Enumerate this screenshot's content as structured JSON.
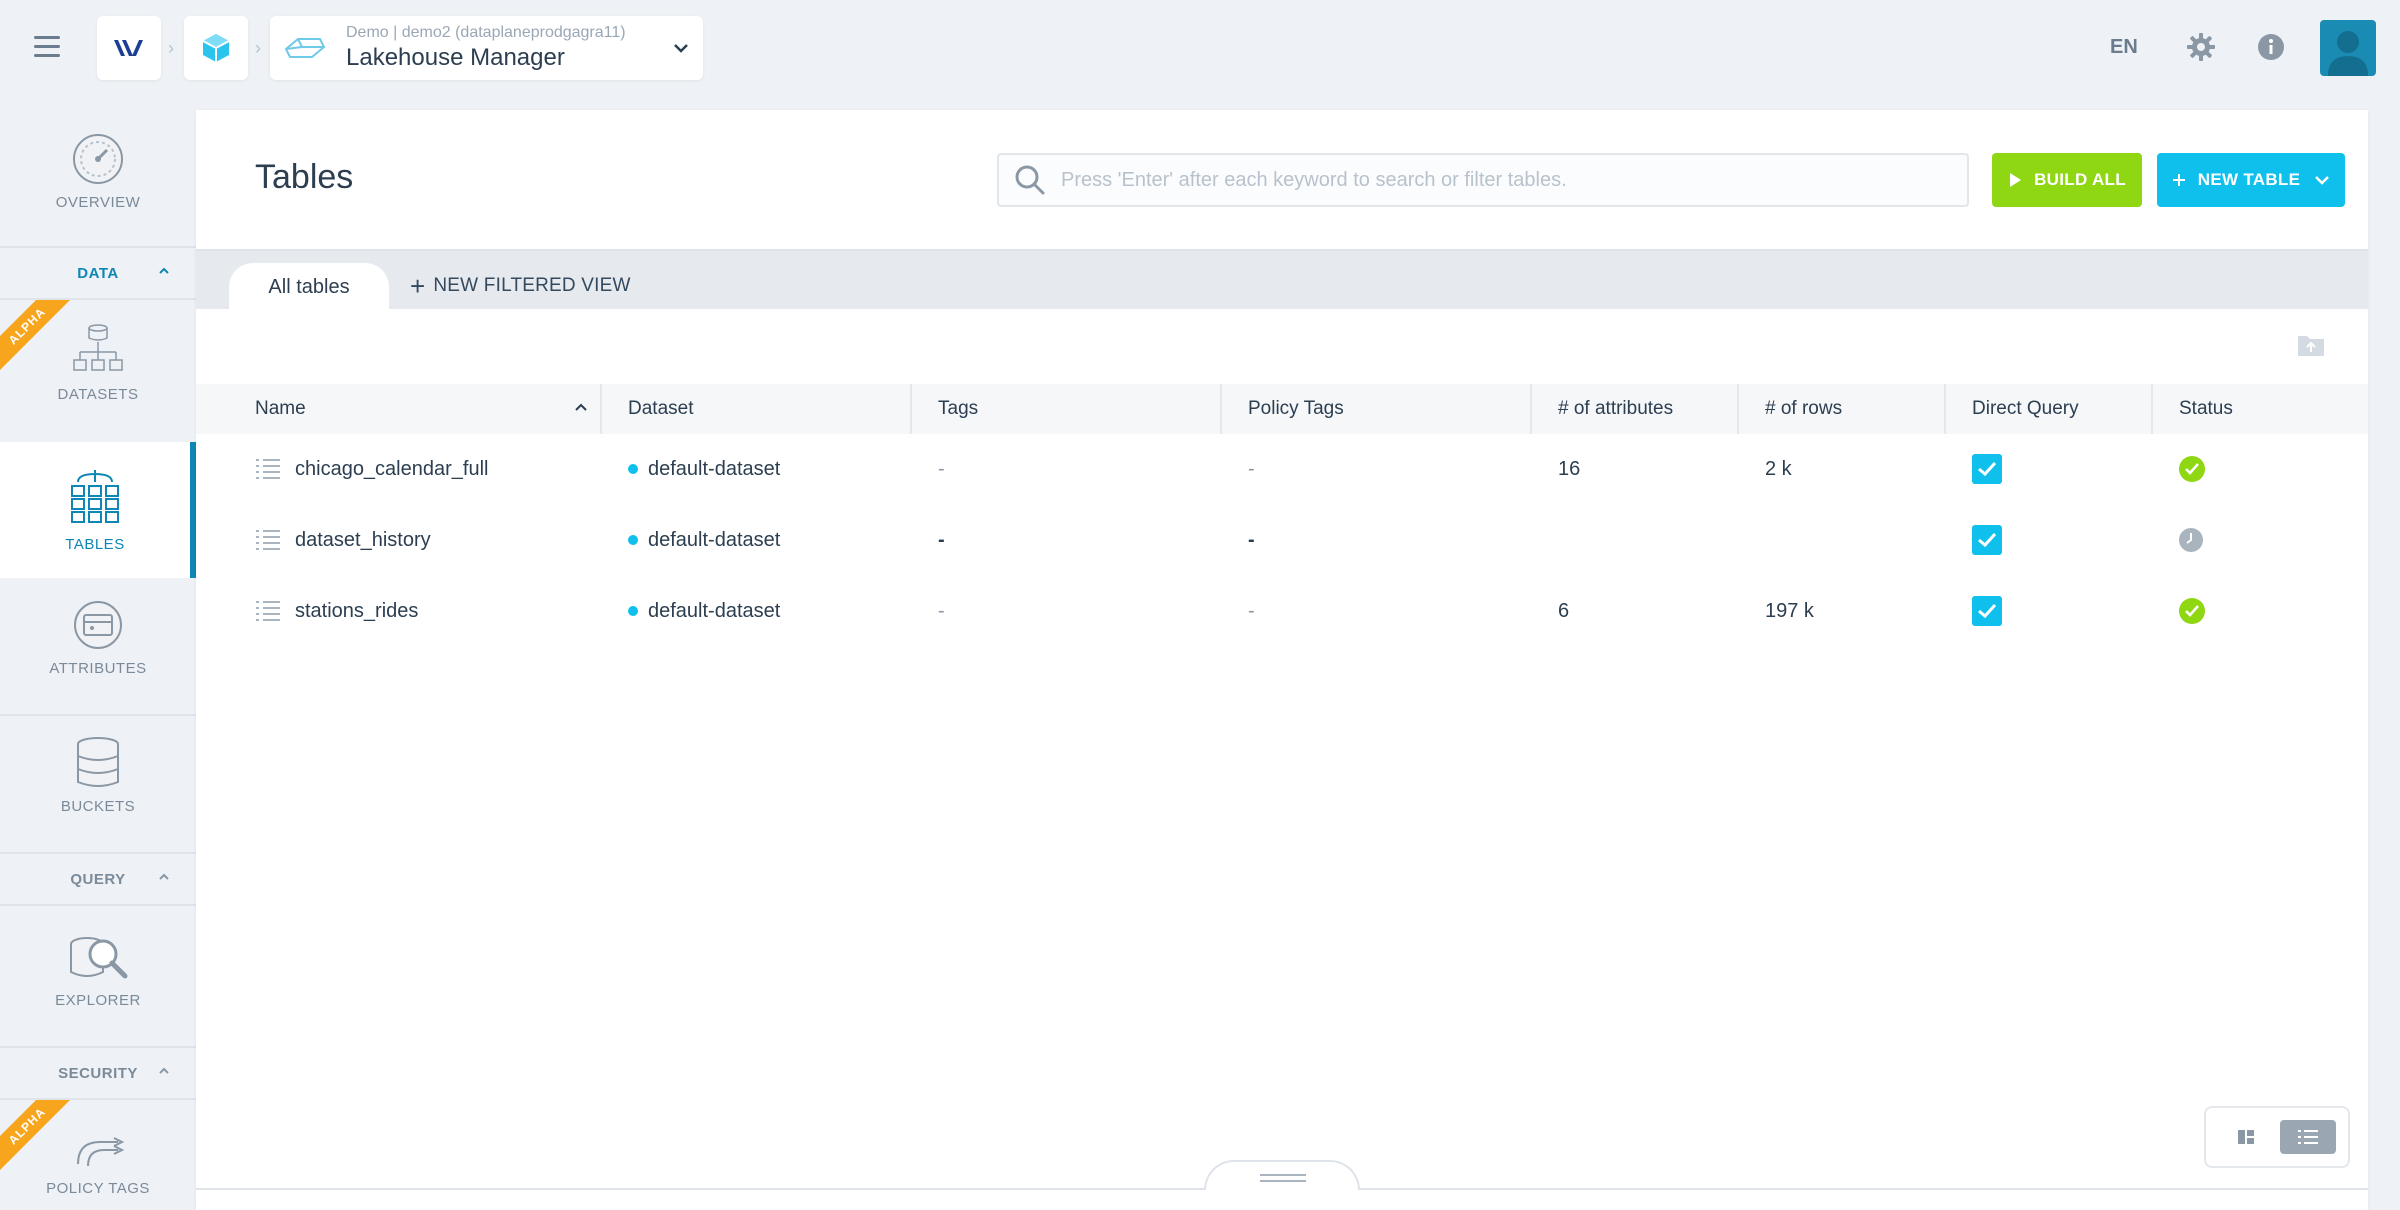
{
  "header": {
    "context": "Demo | demo2 (dataplaneprodgagra11)",
    "app_name": "Lakehouse Manager",
    "language": "EN"
  },
  "sidebar": {
    "overview": "OVERVIEW",
    "sections": {
      "data": "DATA",
      "query": "QUERY",
      "security": "SECURITY"
    },
    "items": {
      "datasets": "DATASETS",
      "tables": "TABLES",
      "attributes": "ATTRIBUTES",
      "buckets": "BUCKETS",
      "explorer": "EXPLORER",
      "policy_tags": "POLICY TAGS"
    },
    "alpha_badge": "ALPHA"
  },
  "main": {
    "title": "Tables",
    "search_placeholder": "Press 'Enter' after each keyword to search or filter tables.",
    "build_all": "BUILD ALL",
    "new_table": "NEW TABLE",
    "tabs": {
      "all_tables": "All tables",
      "new_filtered_view": "NEW FILTERED VIEW"
    },
    "columns": [
      "Name",
      "Dataset",
      "Tags",
      "Policy Tags",
      "# of attributes",
      "# of rows",
      "Direct Query",
      "Status"
    ],
    "rows": [
      {
        "name": "chicago_calendar_full",
        "dataset": "default-dataset",
        "tags": "-",
        "policy_tags": "-",
        "attributes": "16",
        "rows": "2 k",
        "direct_query": true,
        "status": "ok"
      },
      {
        "name": "dataset_history",
        "dataset": "default-dataset",
        "tags": "-",
        "policy_tags": "-",
        "attributes": "",
        "rows": "",
        "direct_query": true,
        "status": "pending"
      },
      {
        "name": "stations_rides",
        "dataset": "default-dataset",
        "tags": "-",
        "policy_tags": "-",
        "attributes": "6",
        "rows": "197 k",
        "direct_query": true,
        "status": "ok"
      }
    ]
  },
  "colors": {
    "accent": "#0f87b4",
    "cyan": "#0fc0ed",
    "green": "#8fd613",
    "alpha": "#f7a51c"
  }
}
